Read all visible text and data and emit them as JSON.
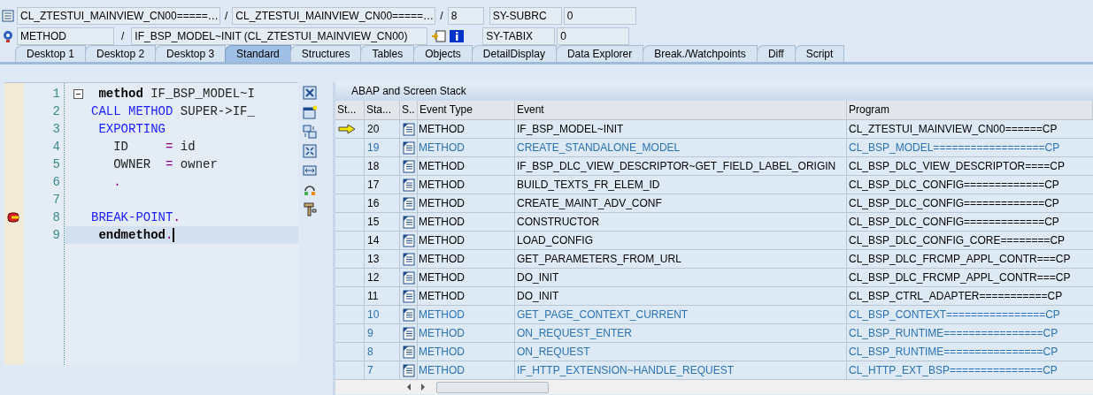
{
  "header": {
    "rows": [
      {
        "fields": [
          "CL_ZTESTUI_MAINVIEW_CN00=====…",
          "CL_ZTESTUI_MAINVIEW_CN00=====…",
          "8"
        ],
        "sys_label": "SY-SUBRC",
        "sys_value": "0"
      },
      {
        "fields": [
          "METHOD",
          "IF_BSP_MODEL~INIT (CL_ZTESTUI_MAINVIEW_CN00)"
        ],
        "sys_label": "SY-TABIX",
        "sys_value": "0"
      }
    ],
    "separator": "/"
  },
  "tabs": [
    {
      "label": "Desktop 1",
      "selected": false
    },
    {
      "label": "Desktop 2",
      "selected": false
    },
    {
      "label": "Desktop 3",
      "selected": false
    },
    {
      "label": "Standard",
      "selected": true
    },
    {
      "label": "Structures",
      "selected": false
    },
    {
      "label": "Tables",
      "selected": false
    },
    {
      "label": "Objects",
      "selected": false
    },
    {
      "label": "DetailDisplay",
      "selected": false
    },
    {
      "label": "Data Explorer",
      "selected": false
    },
    {
      "label": "Break./Watchpoints",
      "selected": false
    },
    {
      "label": "Diff",
      "selected": false
    },
    {
      "label": "Script",
      "selected": false
    }
  ],
  "editor": {
    "lines": [
      {
        "number": "1",
        "breakpoint": false,
        "current": false,
        "fold": true,
        "tokens": [
          {
            "kind": "bold",
            "text": " method"
          },
          {
            "kind": "plain",
            "text": " IF_BSP_MODEL~I"
          }
        ]
      },
      {
        "number": "2",
        "breakpoint": false,
        "current": false,
        "fold": false,
        "tokens": [
          {
            "kind": "keyword",
            "text": "CALL METHOD"
          },
          {
            "kind": "plain",
            "text": " SUPER->IF_"
          }
        ]
      },
      {
        "number": "3",
        "breakpoint": false,
        "current": false,
        "fold": false,
        "tokens": [
          {
            "kind": "keyword",
            "text": " EXPORTING"
          }
        ]
      },
      {
        "number": "4",
        "breakpoint": false,
        "current": false,
        "fold": false,
        "tokens": [
          {
            "kind": "plain",
            "text": "   ID     "
          },
          {
            "kind": "operator",
            "text": "="
          },
          {
            "kind": "plain",
            "text": " id"
          }
        ]
      },
      {
        "number": "5",
        "breakpoint": false,
        "current": false,
        "fold": false,
        "tokens": [
          {
            "kind": "plain",
            "text": "   OWNER  "
          },
          {
            "kind": "operator",
            "text": "="
          },
          {
            "kind": "plain",
            "text": " owner"
          }
        ]
      },
      {
        "number": "6",
        "breakpoint": false,
        "current": false,
        "fold": false,
        "tokens": [
          {
            "kind": "operator",
            "text": "   ."
          }
        ]
      },
      {
        "number": "7",
        "breakpoint": false,
        "current": false,
        "fold": false
      },
      {
        "number": "8",
        "breakpoint": true,
        "current": false,
        "fold": false,
        "tokens": [
          {
            "kind": "keyword",
            "text": "BREAK-POINT"
          },
          {
            "kind": "operator",
            "text": "."
          }
        ]
      },
      {
        "number": "9",
        "breakpoint": false,
        "current": true,
        "fold": false,
        "tokens": [
          {
            "kind": "bold",
            "text": " endmethod"
          },
          {
            "kind": "operator",
            "text": "."
          }
        ]
      }
    ]
  },
  "stack": {
    "title": "ABAP and Screen Stack",
    "columns": [
      "St...",
      "Sta...",
      "S..",
      "Event Type",
      "Event",
      "Program"
    ],
    "rows": [
      {
        "current": true,
        "kind": "normal",
        "level": "20",
        "event_type": "METHOD",
        "event": "IF_BSP_MODEL~INIT",
        "program": "CL_ZTESTUI_MAINVIEW_CN00======CP"
      },
      {
        "current": false,
        "kind": "system",
        "level": "19",
        "event_type": "METHOD",
        "event": "CREATE_STANDALONE_MODEL",
        "program": "CL_BSP_MODEL==================CP"
      },
      {
        "current": false,
        "kind": "normal",
        "level": "18",
        "event_type": "METHOD",
        "event": "IF_BSP_DLC_VIEW_DESCRIPTOR~GET_FIELD_LABEL_ORIGIN",
        "program": "CL_BSP_DLC_VIEW_DESCRIPTOR====CP"
      },
      {
        "current": false,
        "kind": "normal",
        "level": "17",
        "event_type": "METHOD",
        "event": "BUILD_TEXTS_FR_ELEM_ID",
        "program": "CL_BSP_DLC_CONFIG=============CP"
      },
      {
        "current": false,
        "kind": "normal",
        "level": "16",
        "event_type": "METHOD",
        "event": "CREATE_MAINT_ADV_CONF",
        "program": "CL_BSP_DLC_CONFIG=============CP"
      },
      {
        "current": false,
        "kind": "normal",
        "level": "15",
        "event_type": "METHOD",
        "event": "CONSTRUCTOR",
        "program": "CL_BSP_DLC_CONFIG=============CP"
      },
      {
        "current": false,
        "kind": "normal",
        "level": "14",
        "event_type": "METHOD",
        "event": "LOAD_CONFIG",
        "program": "CL_BSP_DLC_CONFIG_CORE========CP"
      },
      {
        "current": false,
        "kind": "normal",
        "level": "13",
        "event_type": "METHOD",
        "event": "GET_PARAMETERS_FROM_URL",
        "program": "CL_BSP_DLC_FRCMP_APPL_CONTR===CP"
      },
      {
        "current": false,
        "kind": "normal",
        "level": "12",
        "event_type": "METHOD",
        "event": "DO_INIT",
        "program": "CL_BSP_DLC_FRCMP_APPL_CONTR===CP"
      },
      {
        "current": false,
        "kind": "normal",
        "level": "11",
        "event_type": "METHOD",
        "event": "DO_INIT",
        "program": "CL_BSP_CTRL_ADAPTER===========CP"
      },
      {
        "current": false,
        "kind": "system",
        "level": "10",
        "event_type": "METHOD",
        "event": "GET_PAGE_CONTEXT_CURRENT",
        "program": "CL_BSP_CONTEXT================CP"
      },
      {
        "current": false,
        "kind": "system",
        "level": "9",
        "event_type": "METHOD",
        "event": "ON_REQUEST_ENTER",
        "program": "CL_BSP_RUNTIME================CP"
      },
      {
        "current": false,
        "kind": "system",
        "level": "8",
        "event_type": "METHOD",
        "event": "ON_REQUEST",
        "program": "CL_BSP_RUNTIME================CP"
      },
      {
        "current": false,
        "kind": "system",
        "level": "7",
        "event_type": "METHOD",
        "event": "IF_HTTP_EXTENSION~HANDLE_REQUEST",
        "program": "CL_HTTP_EXT_BSP===============CP"
      }
    ]
  }
}
